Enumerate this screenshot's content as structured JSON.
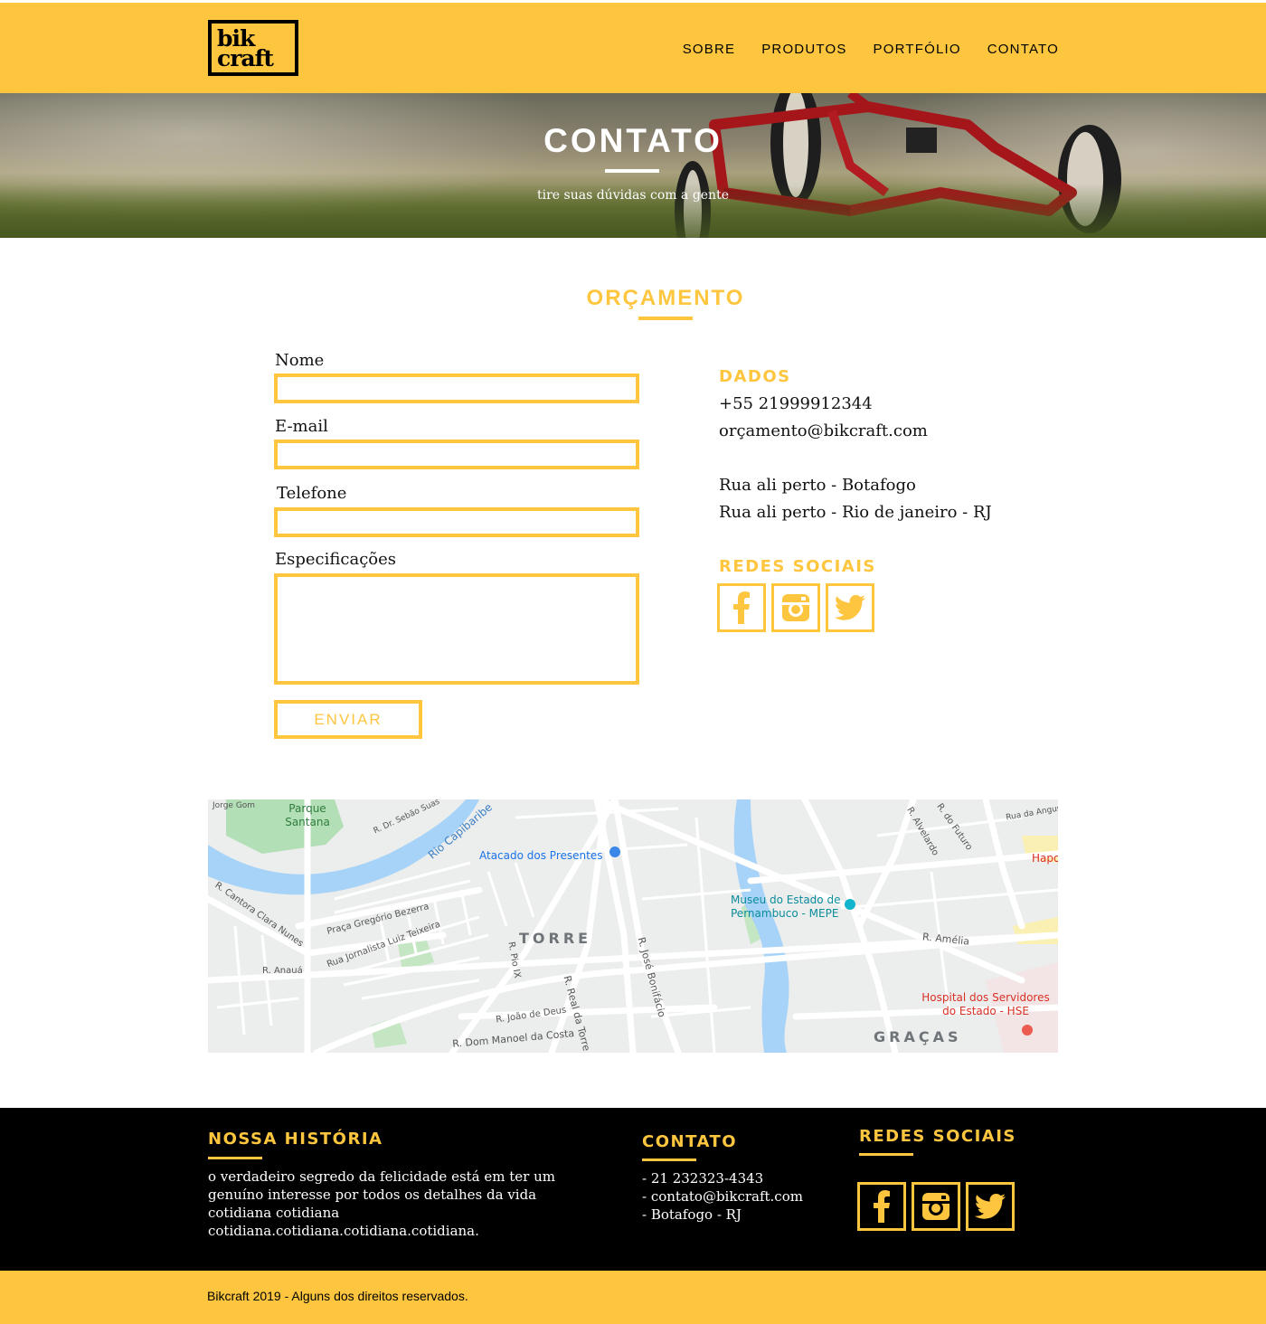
{
  "brand": {
    "logo_line1": "bik",
    "logo_line2": "craft"
  },
  "nav": {
    "items": [
      "SOBRE",
      "PRODUTOS",
      "PORTFÓLIO",
      "CONTATO"
    ]
  },
  "hero": {
    "title": "CONTATO",
    "subtitle": "tire suas dúvidas com a gente"
  },
  "quote": {
    "title": "ORÇAMENTO",
    "fields": [
      {
        "label": "Nome",
        "value": ""
      },
      {
        "label": "E-mail",
        "value": ""
      },
      {
        "label": "Telefone",
        "value": ""
      },
      {
        "label": "Especificações",
        "value": ""
      }
    ],
    "submit_label": "ENVIAR"
  },
  "info": {
    "data_heading": "DADOS",
    "phone": "+55 21999912344",
    "email": "orçamento@bikcraft.com",
    "address_line1": "Rua ali perto - Botafogo",
    "address_line2": "Rua ali perto - Rio de janeiro - RJ",
    "social_heading": "REDES SOCIAIS",
    "social": [
      "facebook-icon",
      "instagram-icon",
      "twitter-icon"
    ]
  },
  "map": {
    "labels": {
      "park": "Parque Santana",
      "river": "Rio Capibaribe",
      "store": "Atacado dos Presentes",
      "museum": "Museu do Estado de Pernambuco - MEPE",
      "torre": "TORRE",
      "gracas": "GRAÇAS",
      "hospital": "Hospital dos Servidores do Estado - HSE",
      "hapo": "Hapo",
      "rua_amelia": "R. Amélia",
      "rua_jose": "R. José Bonifácio",
      "rua_real": "R. Real da Torre",
      "rua_manoel": "R. Dom Manoel da Costa",
      "rua_joao": "R. João de Deus",
      "rua_pio": "R. Pio IX",
      "praca": "Praça Gregório Bezerra",
      "rua_jornalista": "Rua Jornalista Luiz Teixeira",
      "rua_anaua": "R. Anauá",
      "rua_cantora": "R. Cantora Clara Nunes",
      "rua_sebastiao": "R. Dr. Sebão Suas",
      "rua_futuro": "R. do Futuro",
      "rua_alvelardo": "R. Alvelardo",
      "rua_angust": "Rua da Angust",
      "rua_jorge": "Jorge Gom"
    }
  },
  "footer": {
    "history_heading": "NOSSA HISTÓRIA",
    "history_text": "o verdadeiro segredo da felicidade está em ter um genuíno interesse por todos os detalhes da vida cotidiana cotidiana  cotidiana.cotidiana.cotidiana.cotidiana.",
    "contact_heading": "CONTATO",
    "contact_phone": "- 21 232323-4343",
    "contact_email": "- contato@bikcraft.com",
    "contact_place": "- Botafogo - RJ",
    "social_heading": "REDES SOCIAIS",
    "copyright": "Bikcraft 2019 - Alguns dos direitos reservados."
  },
  "colors": {
    "accent": "#fec63f",
    "dark": "#000000"
  }
}
